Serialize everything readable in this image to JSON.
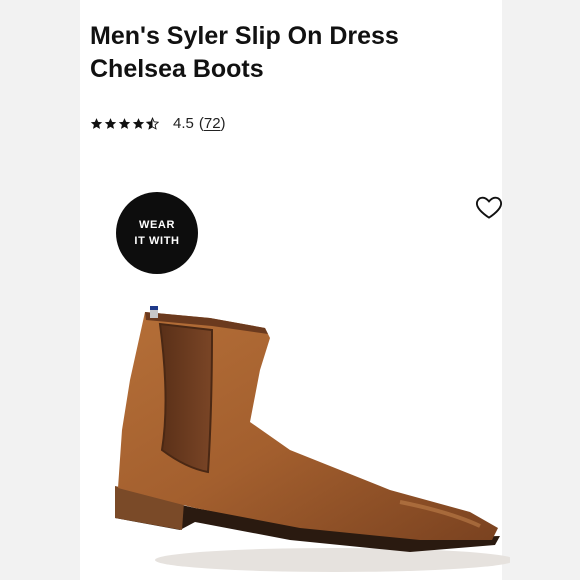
{
  "product": {
    "title": "Men's Syler Slip On Dress Chelsea Boots",
    "rating_value": "4.5",
    "rating_count": "72",
    "rating_stars": 4.5
  },
  "badge": {
    "line1": "WEAR",
    "line2": "IT WITH"
  },
  "icons": {
    "favorite": "heart-outline-icon",
    "rating": "star-icon"
  },
  "colors": {
    "text": "#111111",
    "badge_bg": "#0d0d0d",
    "boot_leather": "#a35f2e",
    "boot_elastic": "#6b3a1e",
    "boot_sole": "#2a1a10"
  }
}
